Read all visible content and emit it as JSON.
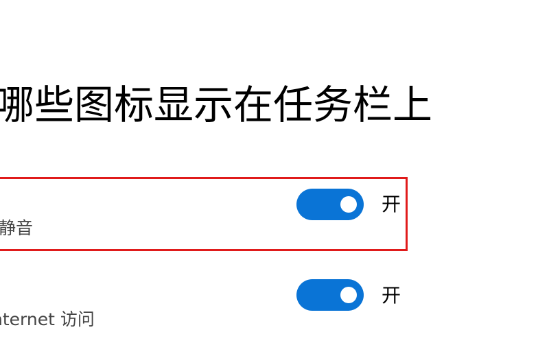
{
  "page": {
    "title": "哪些图标显示在任务栏上"
  },
  "rows": [
    {
      "description": "静音",
      "toggle_state_label": "开",
      "toggle_on": true,
      "highlighted": true
    },
    {
      "description": "nternet 访问",
      "toggle_state_label": "开",
      "toggle_on": true,
      "highlighted": false
    }
  ],
  "colors": {
    "toggle_on": "#0a74d6",
    "highlight_border": "#e01b1b",
    "background": "#ffffff"
  },
  "icons": [
    "toggle-knob"
  ]
}
